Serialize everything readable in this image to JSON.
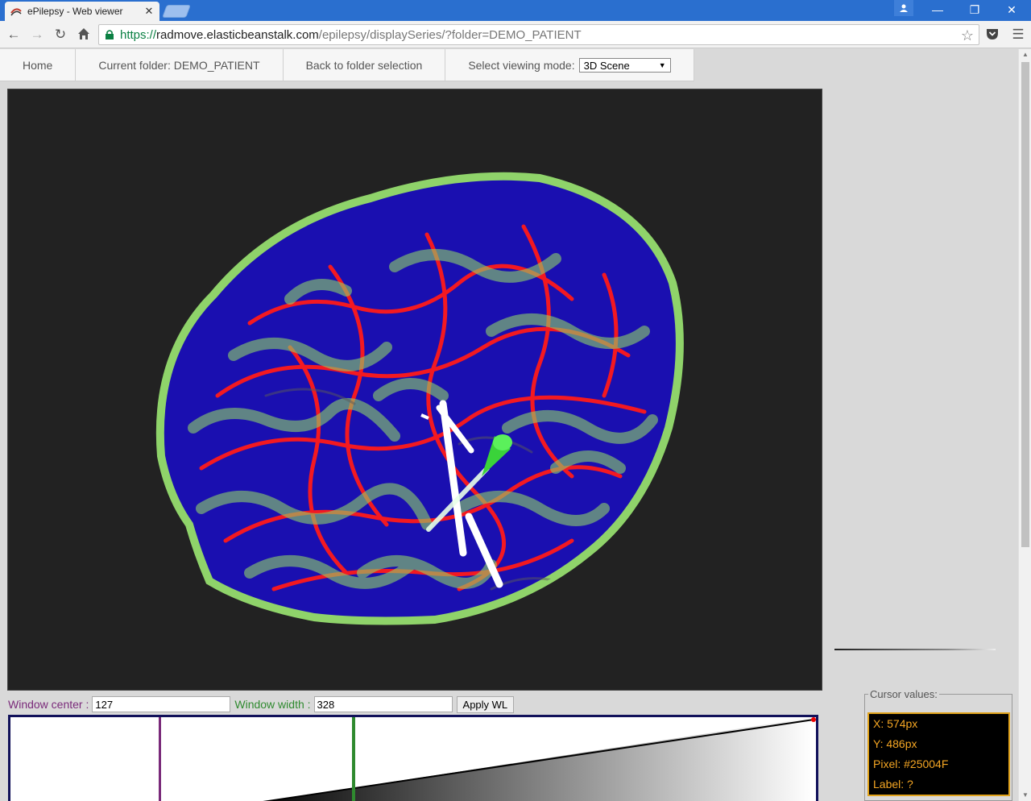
{
  "browser": {
    "tab_title": "ePilepsy - Web viewer",
    "tab_close": "✕",
    "url_scheme": "https://",
    "url_host": "radmove.elasticbeanstalk.com",
    "url_path": "/epilepsy/displaySeries/?folder=DEMO_PATIENT",
    "controls": {
      "minimize": "—",
      "restore": "❐",
      "close": "✕"
    }
  },
  "menu": {
    "home": "Home",
    "current_folder": "Current folder: DEMO_PATIENT",
    "back": "Back to folder selection",
    "viewing_mode_label": "Select viewing mode:",
    "viewing_mode_value": "3D Scene"
  },
  "window_level": {
    "center_label": "Window center :",
    "center_value": "127",
    "width_label": "Window width :",
    "width_value": "328",
    "apply_label": "Apply WL"
  },
  "cursor": {
    "legend": "Cursor values:",
    "x": "X: 574px",
    "y": "Y: 486px",
    "pixel": "Pixel: #25004F",
    "label": "Label: ?"
  },
  "colors": {
    "titlebar": "#2a6fcf",
    "viewer_bg": "#222222",
    "cortex_green": "#8fd36a",
    "vessels_red": "#ff1a1a",
    "white_matter_blue": "#1a0fb0",
    "electrode_white": "#ffffff",
    "probe_green": "#3ad33a",
    "center_marker": "#7a2a7a",
    "width_marker": "#2f8a2f",
    "cursor_text": "#f5a623"
  }
}
